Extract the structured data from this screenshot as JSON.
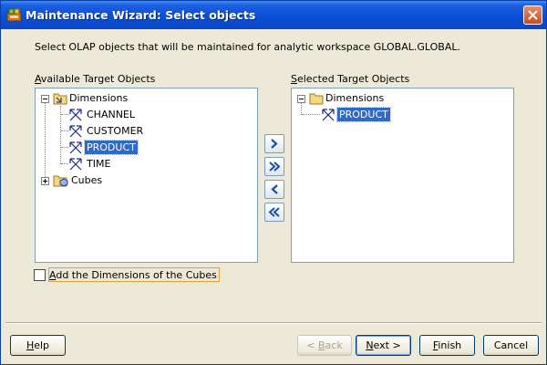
{
  "window": {
    "title": "Maintenance Wizard: Select objects"
  },
  "instruction": "Select OLAP objects that will be maintained for analytic workspace GLOBAL.GLOBAL.",
  "available": {
    "label_mnemonic": "A",
    "label_rest": "vailable Target Objects",
    "tree": {
      "dimensions_label": "Dimensions",
      "dimensions": [
        "CHANNEL",
        "CUSTOMER",
        "PRODUCT",
        "TIME"
      ],
      "selected_item": "PRODUCT",
      "cubes_label": "Cubes"
    }
  },
  "selected": {
    "label_mnemonic": "S",
    "label_rest": "elected Target Objects",
    "tree": {
      "dimensions_label": "Dimensions",
      "dimensions": [
        "PRODUCT"
      ],
      "selected_item": "PRODUCT"
    }
  },
  "move_buttons": [
    {
      "name": "add-selected-button",
      "icon": "chevron-right-icon"
    },
    {
      "name": "add-all-button",
      "icon": "double-chevron-right-icon"
    },
    {
      "name": "remove-selected-button",
      "icon": "chevron-left-icon"
    },
    {
      "name": "remove-all-button",
      "icon": "double-chevron-left-icon"
    }
  ],
  "checkbox": {
    "mnemonic": "A",
    "label_rest": "dd the Dimensions of the Cubes",
    "checked": false
  },
  "buttons": {
    "help_mnemonic": "H",
    "help_rest": "elp",
    "back_prefix": "< ",
    "back_mnemonic": "B",
    "back_rest": "ack",
    "back_enabled": false,
    "next_mnemonic": "N",
    "next_rest": "ext >",
    "finish_mnemonic": "F",
    "finish_rest": "inish",
    "cancel_label": "Cancel"
  },
  "colors": {
    "titlebar": "#0a4fd6",
    "selection": "#316ac5",
    "dialog_bg": "#ece9d8"
  }
}
